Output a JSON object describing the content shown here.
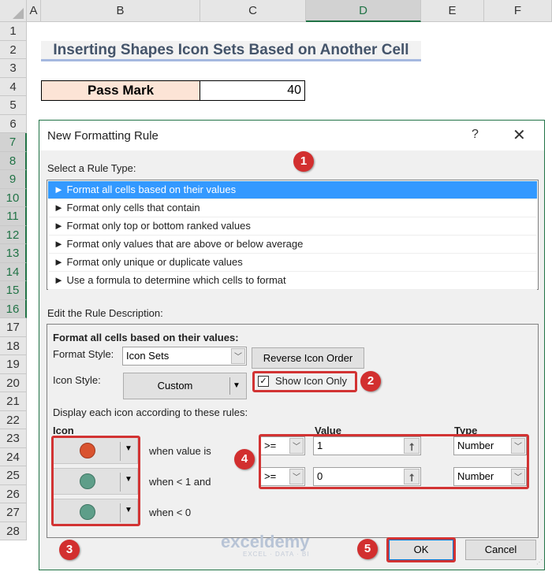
{
  "spreadsheet": {
    "columns": [
      "A",
      "B",
      "C",
      "D",
      "E",
      "F"
    ],
    "selected_column": "D",
    "rows": [
      "1",
      "2",
      "3",
      "4",
      "5",
      "6",
      "7",
      "8",
      "9",
      "10",
      "11",
      "12",
      "13",
      "14",
      "15",
      "16",
      "17",
      "18",
      "19",
      "20",
      "21",
      "22",
      "23",
      "24",
      "25",
      "26",
      "27",
      "28"
    ],
    "title": "Inserting Shapes Icon Sets Based on Another Cell",
    "pass_mark_label": "Pass Mark",
    "pass_mark_value": "40"
  },
  "dialog": {
    "title": "New Formatting Rule",
    "help": "?",
    "close": "✕",
    "select_rule_type_label": "Select a Rule Type:",
    "rule_types": [
      "► Format all cells based on their values",
      "► Format only cells that contain",
      "► Format only top or bottom ranked values",
      "► Format only values that are above or below average",
      "► Format only unique or duplicate values",
      "► Use a formula to determine which cells to format"
    ],
    "selected_rule_index": 0,
    "edit_description_label": "Edit the Rule Description:",
    "format_all_heading": "Format all cells based on their values:",
    "format_style_label": "Format Style:",
    "format_style_value": "Icon Sets",
    "reverse_icon_order": "Reverse Icon Order",
    "icon_style_label": "Icon Style:",
    "icon_style_value": "Custom",
    "show_icon_only_label": "Show Icon Only",
    "show_icon_only_checked": true,
    "display_rules_label": "Display each icon according to these rules:",
    "icon_header": "Icon",
    "value_header": "Value",
    "type_header": "Type",
    "icon_rules": [
      {
        "icon_color": "#d9532f",
        "condition_text": "when value is",
        "operator": ">=",
        "value": "1",
        "type": "Number"
      },
      {
        "icon_color": "#5e9e89",
        "condition_text": "when < 1 and",
        "operator": ">=",
        "value": "0",
        "type": "Number"
      },
      {
        "icon_color": "#5e9e89",
        "condition_text": "when < 0"
      }
    ],
    "ok_label": "OK",
    "cancel_label": "Cancel"
  },
  "annotations": [
    "1",
    "2",
    "3",
    "4",
    "5"
  ],
  "watermark": {
    "name": "exceldemy",
    "tagline": "EXCEL · DATA · BI"
  }
}
